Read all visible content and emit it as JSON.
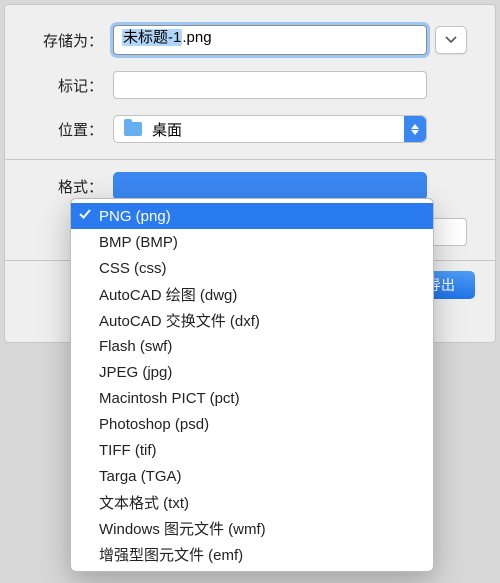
{
  "labels": {
    "save_as": "存储为：",
    "tags": "标记：",
    "location": "位置：",
    "format": "格式："
  },
  "filename": {
    "base_selected": "未标题-1",
    "ext": ".png"
  },
  "location": {
    "folder_name": "桌面"
  },
  "export_button": "导出",
  "format_options": [
    "PNG (png)",
    "BMP (BMP)",
    "CSS (css)",
    "AutoCAD 绘图 (dwg)",
    "AutoCAD 交换文件 (dxf)",
    "Flash (swf)",
    "JPEG (jpg)",
    "Macintosh PICT (pct)",
    "Photoshop (psd)",
    "TIFF (tif)",
    "Targa (TGA)",
    "文本格式 (txt)",
    "Windows 图元文件 (wmf)",
    "增强型图元文件 (emf)"
  ],
  "selected_format_index": 0
}
